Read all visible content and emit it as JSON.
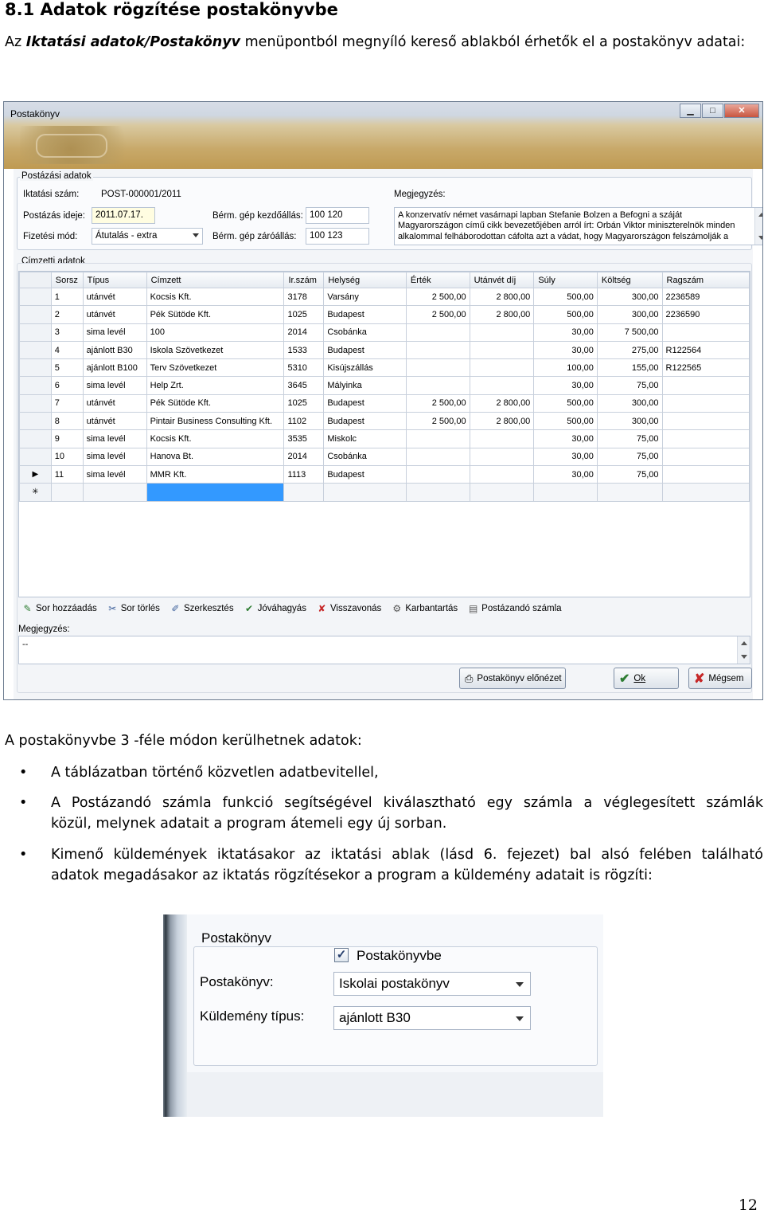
{
  "heading": "8.1 Adatok rögzítése postakönyvbe",
  "intro": {
    "prefix": "Az ",
    "menu": "Iktatási adatok/Postakönyv",
    "suffix": " menüpontból megnyíló kereső ablakból érhetők el a postakönyv adatai:"
  },
  "window": {
    "title": "Postakönyv",
    "buttons": {
      "minimize": "▁",
      "maximize": "□",
      "close": "✕"
    },
    "postal_group": {
      "label": "Postázási adatok",
      "iktatasi_szam_label": "Iktatási szám:",
      "iktatasi_szam_value": "POST-000001/2011",
      "postazas_ideje_label": "Postázás ideje:",
      "postazas_ideje_value": "2011.07.17.",
      "fizetesi_mod_label": "Fizetési mód:",
      "fizetesi_mod_value": "Átutalás - extra",
      "berm_kezd_label": "Bérm. gép kezdőállás:",
      "berm_kezd_value": "100 120",
      "berm_zaro_label": "Bérm. gép záróállás:",
      "berm_zaro_value": "100 123",
      "megjegyzes_label": "Megjegyzés:",
      "megjegyzes_lines": [
        "A konzervatív német vasárnapi lapban Stefanie Bolzen a Befogni a száját",
        "Magyarországon című cikk bevezetőjében arról írt: Orbán Viktor miniszterelnök minden",
        "alkalommal felháborodottan cáfolta azt a vádat, hogy Magyarországon felszámolják a"
      ]
    },
    "recipient_group": {
      "label": "Címzetti adatok",
      "columns": [
        "Sorsz",
        "Típus",
        "Címzett",
        "Ir.szám",
        "Helység",
        "Érték",
        "Utánvét díj",
        "Súly",
        "Költség",
        "Ragszám"
      ],
      "rows": [
        [
          "1",
          "utánvét",
          "Kocsis Kft.",
          "3178",
          "Varsány",
          "2 500,00",
          "2 800,00",
          "500,00",
          "300,00",
          "2236589"
        ],
        [
          "2",
          "utánvét",
          "Pék Sütöde Kft.",
          "1025",
          "Budapest",
          "2 500,00",
          "2 800,00",
          "500,00",
          "300,00",
          "2236590"
        ],
        [
          "3",
          "sima levél",
          "100",
          "2014",
          "Csobánka",
          "",
          "",
          "30,00",
          "7 500,00",
          ""
        ],
        [
          "4",
          "ajánlott B30",
          "Iskola Szövetkezet",
          "1533",
          "Budapest",
          "",
          "",
          "30,00",
          "275,00",
          "R122564"
        ],
        [
          "5",
          "ajánlott B100",
          "Terv Szövetkezet",
          "5310",
          "Kisújszállás",
          "",
          "",
          "100,00",
          "155,00",
          "R122565"
        ],
        [
          "6",
          "sima levél",
          "Help Zrt.",
          "3645",
          "Mályinka",
          "",
          "",
          "30,00",
          "75,00",
          ""
        ],
        [
          "7",
          "utánvét",
          "Pék Sütöde Kft.",
          "1025",
          "Budapest",
          "2 500,00",
          "2 800,00",
          "500,00",
          "300,00",
          ""
        ],
        [
          "8",
          "utánvét",
          "Pintair Business Consulting Kft.",
          "1102",
          "Budapest",
          "2 500,00",
          "2 800,00",
          "500,00",
          "300,00",
          ""
        ],
        [
          "9",
          "sima levél",
          "Kocsis Kft.",
          "3535",
          "Miskolc",
          "",
          "",
          "30,00",
          "75,00",
          ""
        ],
        [
          "10",
          "sima levél",
          "Hanova Bt.",
          "2014",
          "Csobánka",
          "",
          "",
          "30,00",
          "75,00",
          ""
        ],
        [
          "11",
          "sima levél",
          "MMR Kft.",
          "1113",
          "Budapest",
          "",
          "",
          "30,00",
          "75,00",
          ""
        ]
      ],
      "current_row_marker": "▶",
      "new_row_marker": "✳"
    },
    "toolbar": [
      {
        "name": "sor-hozzaadas",
        "label": "Sor hozzáadás",
        "icon": "add-row-icon",
        "glyph": "✎",
        "color": "#2e7d32"
      },
      {
        "name": "sor-torles",
        "label": "Sor törlés",
        "icon": "delete-row-icon",
        "glyph": "✂",
        "color": "#3b5f9a"
      },
      {
        "name": "szerkesztes",
        "label": "Szerkesztés",
        "icon": "edit-icon",
        "glyph": "✐",
        "color": "#3b5f9a"
      },
      {
        "name": "jovahagyas",
        "label": "Jóváhagyás",
        "icon": "approve-icon",
        "glyph": "✔",
        "color": "#2e7d32"
      },
      {
        "name": "visszavonas",
        "label": "Visszavonás",
        "icon": "revoke-icon",
        "glyph": "✘",
        "color": "#c62828"
      },
      {
        "name": "karbantartas",
        "label": "Karbantartás",
        "icon": "gear-icon",
        "glyph": "⚙",
        "color": "#555555"
      },
      {
        "name": "postazando-szamla",
        "label": "Postázandó számla",
        "icon": "invoice-icon",
        "glyph": "▤",
        "color": "#555555"
      }
    ],
    "bottom_note_label": "Megjegyzés:",
    "bottom_note_value": "--",
    "preview_button": "Postakönyv előnézet",
    "ok_button": "Ok",
    "cancel_button": "Mégsem",
    "colors": {
      "selected_cell": "#3399ff",
      "ok_check": "#2e7d32",
      "cancel_x": "#c62828"
    }
  },
  "body": {
    "lead": "A postakönyvbe 3 -féle módon kerülhetnek adatok:",
    "bullet": "•",
    "bullets": [
      [
        "A táblázatban történő közvetlen adatbevitellel,"
      ],
      [
        "A Postázandó számla funkció segítségével kiválasztható egy számla a véglegesített számlák",
        " közül, melynek adatait a program átemeli egy új sorban."
      ],
      [
        "Kimenő küldemények iktatásakor az iktatási ablak (lásd 6. fejezet) bal alsó felében található",
        "adatok megadásakor az iktatás rögzítésekor a program a küldemény adatait is rögzíti:"
      ]
    ]
  },
  "dialog2": {
    "group_label": "Postakönyv",
    "checkbox_label": "Postakönyvbe",
    "checkbox_mark": "✓",
    "postakonyv_label": "Postakönyv:",
    "postakonyv_value": "Iskolai postakönyv",
    "kuldemeny_label": "Küldemény típus:",
    "kuldemeny_value": "ajánlott B30"
  },
  "page_number": "12"
}
